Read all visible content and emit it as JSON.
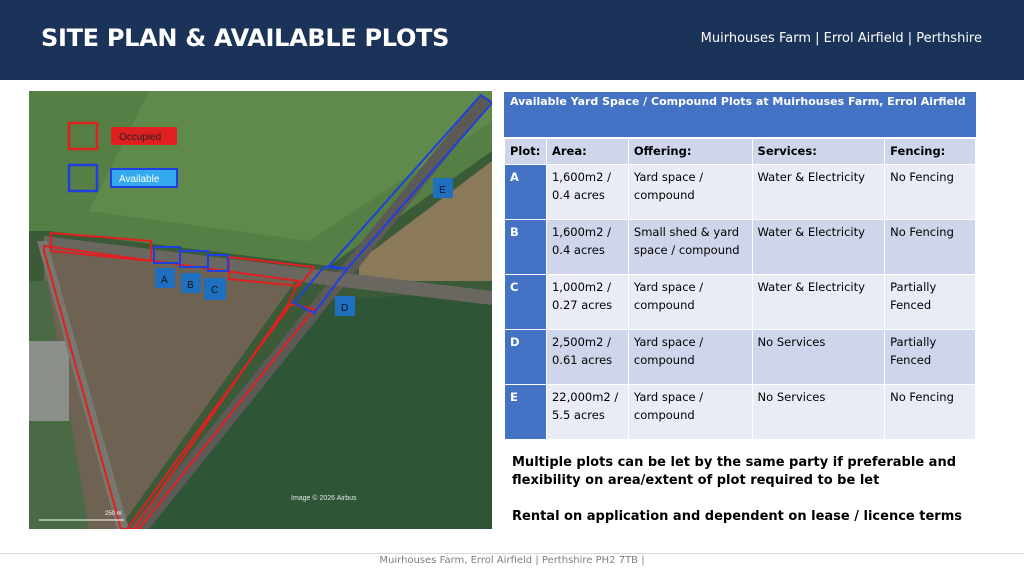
{
  "header": {
    "title": "SITE PLAN & AVAILABLE PLOTS",
    "subtitle": "Muirhouses Farm  |  Errol Airfield  |  Perthshire"
  },
  "map": {
    "legend": {
      "occupied": "Occupied",
      "available": "Available"
    },
    "plot_labels": [
      "A",
      "B",
      "C",
      "D",
      "E"
    ],
    "credit": "Image © 2026 Airbus",
    "scale": "250 m",
    "colors": {
      "occupied": "#e02020",
      "available": "#1f3fe0",
      "label_bg": "#1e6fc0"
    }
  },
  "table": {
    "title": "Available Yard Space / Compound Plots at Muirhouses Farm, Errol Airfield",
    "headers": [
      "Plot:",
      "Area:",
      "Offering:",
      "Services:",
      "Fencing:"
    ],
    "rows": [
      {
        "plot": "A",
        "area1": "1,600m2 /",
        "area2": "0.4 acres",
        "offer1": "Yard space /",
        "offer2": "compound",
        "services": "Water & Electricity",
        "fence1": "No Fencing",
        "fence2": ""
      },
      {
        "plot": "B",
        "area1": "1,600m2 /",
        "area2": "0.4 acres",
        "offer1": "Small shed & yard",
        "offer2": "space / compound",
        "services": "Water & Electricity",
        "fence1": "No Fencing",
        "fence2": ""
      },
      {
        "plot": "C",
        "area1": "1,000m2 /",
        "area2": "0.27 acres",
        "offer1": "Yard space /",
        "offer2": "compound",
        "services": "Water & Electricity",
        "fence1": "Partially",
        "fence2": "Fenced"
      },
      {
        "plot": "D",
        "area1": "2,500m2 /",
        "area2": "0.61 acres",
        "offer1": "Yard space /",
        "offer2": "compound",
        "services": "No Services",
        "fence1": "Partially",
        "fence2": "Fenced"
      },
      {
        "plot": "E",
        "area1": "22,000m2 /",
        "area2": "5.5 acres",
        "offer1": "Yard space /",
        "offer2": "compound",
        "services": "No Services",
        "fence1": "No Fencing",
        "fence2": ""
      }
    ]
  },
  "notes": {
    "multiple": "Multiple plots can be let by the same party if preferable and flexibility on area/extent of plot required to be let",
    "rental": "Rental on application and dependent on lease / licence terms"
  },
  "footer": {
    "text": "Muirhouses Farm, Errol Airfield  |  Perthshire PH2 7TB  |"
  }
}
